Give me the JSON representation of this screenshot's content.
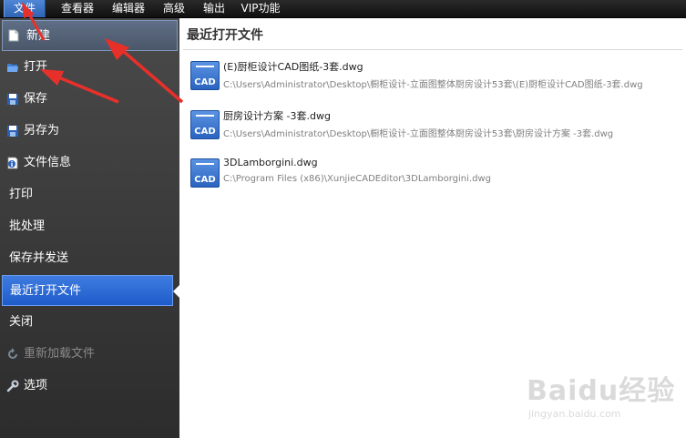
{
  "menubar": {
    "items": [
      {
        "label": "文件",
        "active": true
      },
      {
        "label": "查看器"
      },
      {
        "label": "编辑器"
      },
      {
        "label": "高级"
      },
      {
        "label": "输出"
      },
      {
        "label": "VIP功能"
      }
    ]
  },
  "sidebar": {
    "items": [
      {
        "label": "新建",
        "icon": "new-document-icon",
        "state": "hover"
      },
      {
        "label": "打开",
        "icon": "open-folder-icon"
      },
      {
        "label": "保存",
        "icon": "save-disk-icon"
      },
      {
        "label": "另存为",
        "icon": "save-as-disk-icon"
      },
      {
        "label": "文件信息",
        "icon": "file-info-icon"
      },
      {
        "label": "打印"
      },
      {
        "label": "批处理"
      },
      {
        "label": "保存并发送"
      },
      {
        "label": "最近打开文件",
        "state": "selected"
      },
      {
        "label": "关闭"
      },
      {
        "label": "重新加载文件",
        "icon": "reload-icon",
        "state": "disabled"
      },
      {
        "label": "选项",
        "icon": "wrench-icon"
      }
    ]
  },
  "main": {
    "title": "最近打开文件",
    "recent_files": [
      {
        "name": "(E)厨柜设计CAD图纸-3套.dwg",
        "path": "C:\\Users\\Administrator\\Desktop\\橱柜设计-立面图整体厨房设计53套\\(E)厨柜设计CAD图纸-3套.dwg",
        "icon_label": "CAD"
      },
      {
        "name": "厨房设计方案 -3套.dwg",
        "path": "C:\\Users\\Administrator\\Desktop\\橱柜设计-立面图整体厨房设计53套\\厨房设计方案 -3套.dwg",
        "icon_label": "CAD"
      },
      {
        "name": "3DLamborgini.dwg",
        "path": "C:\\Program Files (x86)\\XunjieCADEditor\\3DLamborgini.dwg",
        "icon_label": "CAD"
      }
    ]
  },
  "watermark": {
    "logo": "Baidu经验",
    "site": "jingyan.baidu.com"
  },
  "colors": {
    "accent": "#2f6fd6",
    "annotation": "#e8302a",
    "sidebar_bg": "#3c3c3c"
  }
}
